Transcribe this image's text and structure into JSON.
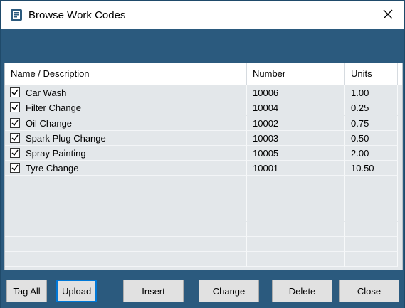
{
  "window": {
    "title": "Browse Work Codes"
  },
  "icons": {
    "app": "app-icon",
    "close": "close-icon",
    "check": "check-icon"
  },
  "grid": {
    "columns": [
      "Name / Description",
      "Number",
      "Units"
    ],
    "rows": [
      {
        "name": "Car Wash",
        "number": "10006",
        "units": "1.00",
        "checked": true
      },
      {
        "name": "Filter Change",
        "number": "10004",
        "units": "0.25",
        "checked": true
      },
      {
        "name": "Oil Change",
        "number": "10002",
        "units": "0.75",
        "checked": true
      },
      {
        "name": "Spark Plug Change",
        "number": "10003",
        "units": "0.50",
        "checked": true
      },
      {
        "name": "Spray Painting",
        "number": "10005",
        "units": "2.00",
        "checked": true
      },
      {
        "name": "Tyre Change",
        "number": "10001",
        "units": "10.50",
        "checked": true
      }
    ]
  },
  "buttons": {
    "tag_all": "Tag All",
    "upload": "Upload",
    "insert": "Insert",
    "change": "Change",
    "delete": "Delete",
    "close": "Close"
  },
  "colors": {
    "frame": "#2b5a7e",
    "grid_bg": "#e3e7ea",
    "accent": "#0078d7"
  }
}
